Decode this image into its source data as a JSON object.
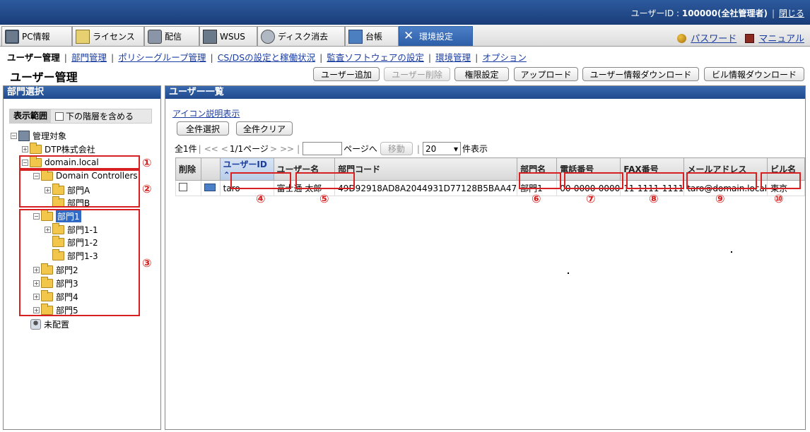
{
  "topbar": {
    "user_label": "ユーザーID : ",
    "user_value": "100000(全社管理者)",
    "separator": "|",
    "close": "閉じる"
  },
  "tabs": [
    {
      "label": "PC情報",
      "icon": "pc-icon"
    },
    {
      "label": "ライセンス",
      "icon": "license-icon"
    },
    {
      "label": "配信",
      "icon": "distribution-icon"
    },
    {
      "label": "WSUS",
      "icon": "wsus-icon"
    },
    {
      "label": "ディスク消去",
      "icon": "disk-erase-icon"
    },
    {
      "label": "台帳",
      "icon": "ledger-icon"
    },
    {
      "label": "環境設定",
      "icon": "tools-icon",
      "active": true
    }
  ],
  "toplinks": {
    "password": "パスワード",
    "manual": "マニュアル"
  },
  "subnav": {
    "current": "ユーザー管理",
    "links": [
      "部門管理",
      "ポリシーグループ管理",
      "CS/DSの設定と稼働状況",
      "監査ソフトウェアの設定",
      "環境管理",
      "オプション"
    ]
  },
  "page_title": "ユーザー管理",
  "toolbar": {
    "add_user": "ユーザー追加",
    "delete_user": "ユーザー削除",
    "permission": "権限設定",
    "upload": "アップロード",
    "user_download": "ユーザー情報ダウンロード",
    "building_download": "ビル情報ダウンロード"
  },
  "left_panel": {
    "title": "部門選択",
    "scope_label": "表示範囲",
    "include_lower": "下の階層を含める",
    "tree": {
      "root": "管理対象",
      "dtp": "DTP株式会社",
      "domain": "domain.local",
      "dc": "Domain Controllers",
      "a": "部門A",
      "b": "部門B",
      "d1": "部門1",
      "d1_1": "部門1-1",
      "d1_2": "部門1-2",
      "d1_3": "部門1-3",
      "d2": "部門2",
      "d3": "部門3",
      "d4": "部門4",
      "d5": "部門5",
      "unassigned": "未配置"
    },
    "annotations": [
      "①",
      "②",
      "③"
    ]
  },
  "right_panel": {
    "title": "ユーザー一覧",
    "icon_legend": "アイコン説明表示",
    "select_all": "全件選択",
    "clear_all": "全件クリア",
    "pager": {
      "count": "全1件",
      "sep": "|",
      "first": "<<",
      "prev": "<",
      "page": "1/1ページ",
      "next": ">",
      "last": ">>",
      "goto_suffix": "ページへ",
      "move": "移動",
      "per_page": "20",
      "per_page_suffix": "件表示"
    },
    "columns": [
      "削除",
      "",
      "ユーザーID",
      "ユーザー名",
      "部門コード",
      "部門名",
      "電話番号",
      "FAX番号",
      "メールアドレス",
      "ビル名"
    ],
    "rows": [
      {
        "user_id": "taro",
        "user_name": "富士通 太郎",
        "dept_code": "49D92918AD8A2044931D77128B5BAA47",
        "dept_name": "部門1",
        "phone": "00-0000-0000",
        "fax": "11-1111-1111",
        "email": "taro@domain.local",
        "building": "東京"
      }
    ],
    "annotations": [
      "④",
      "⑤",
      "⑥",
      "⑦",
      "⑧",
      "⑨",
      "⑩"
    ]
  }
}
